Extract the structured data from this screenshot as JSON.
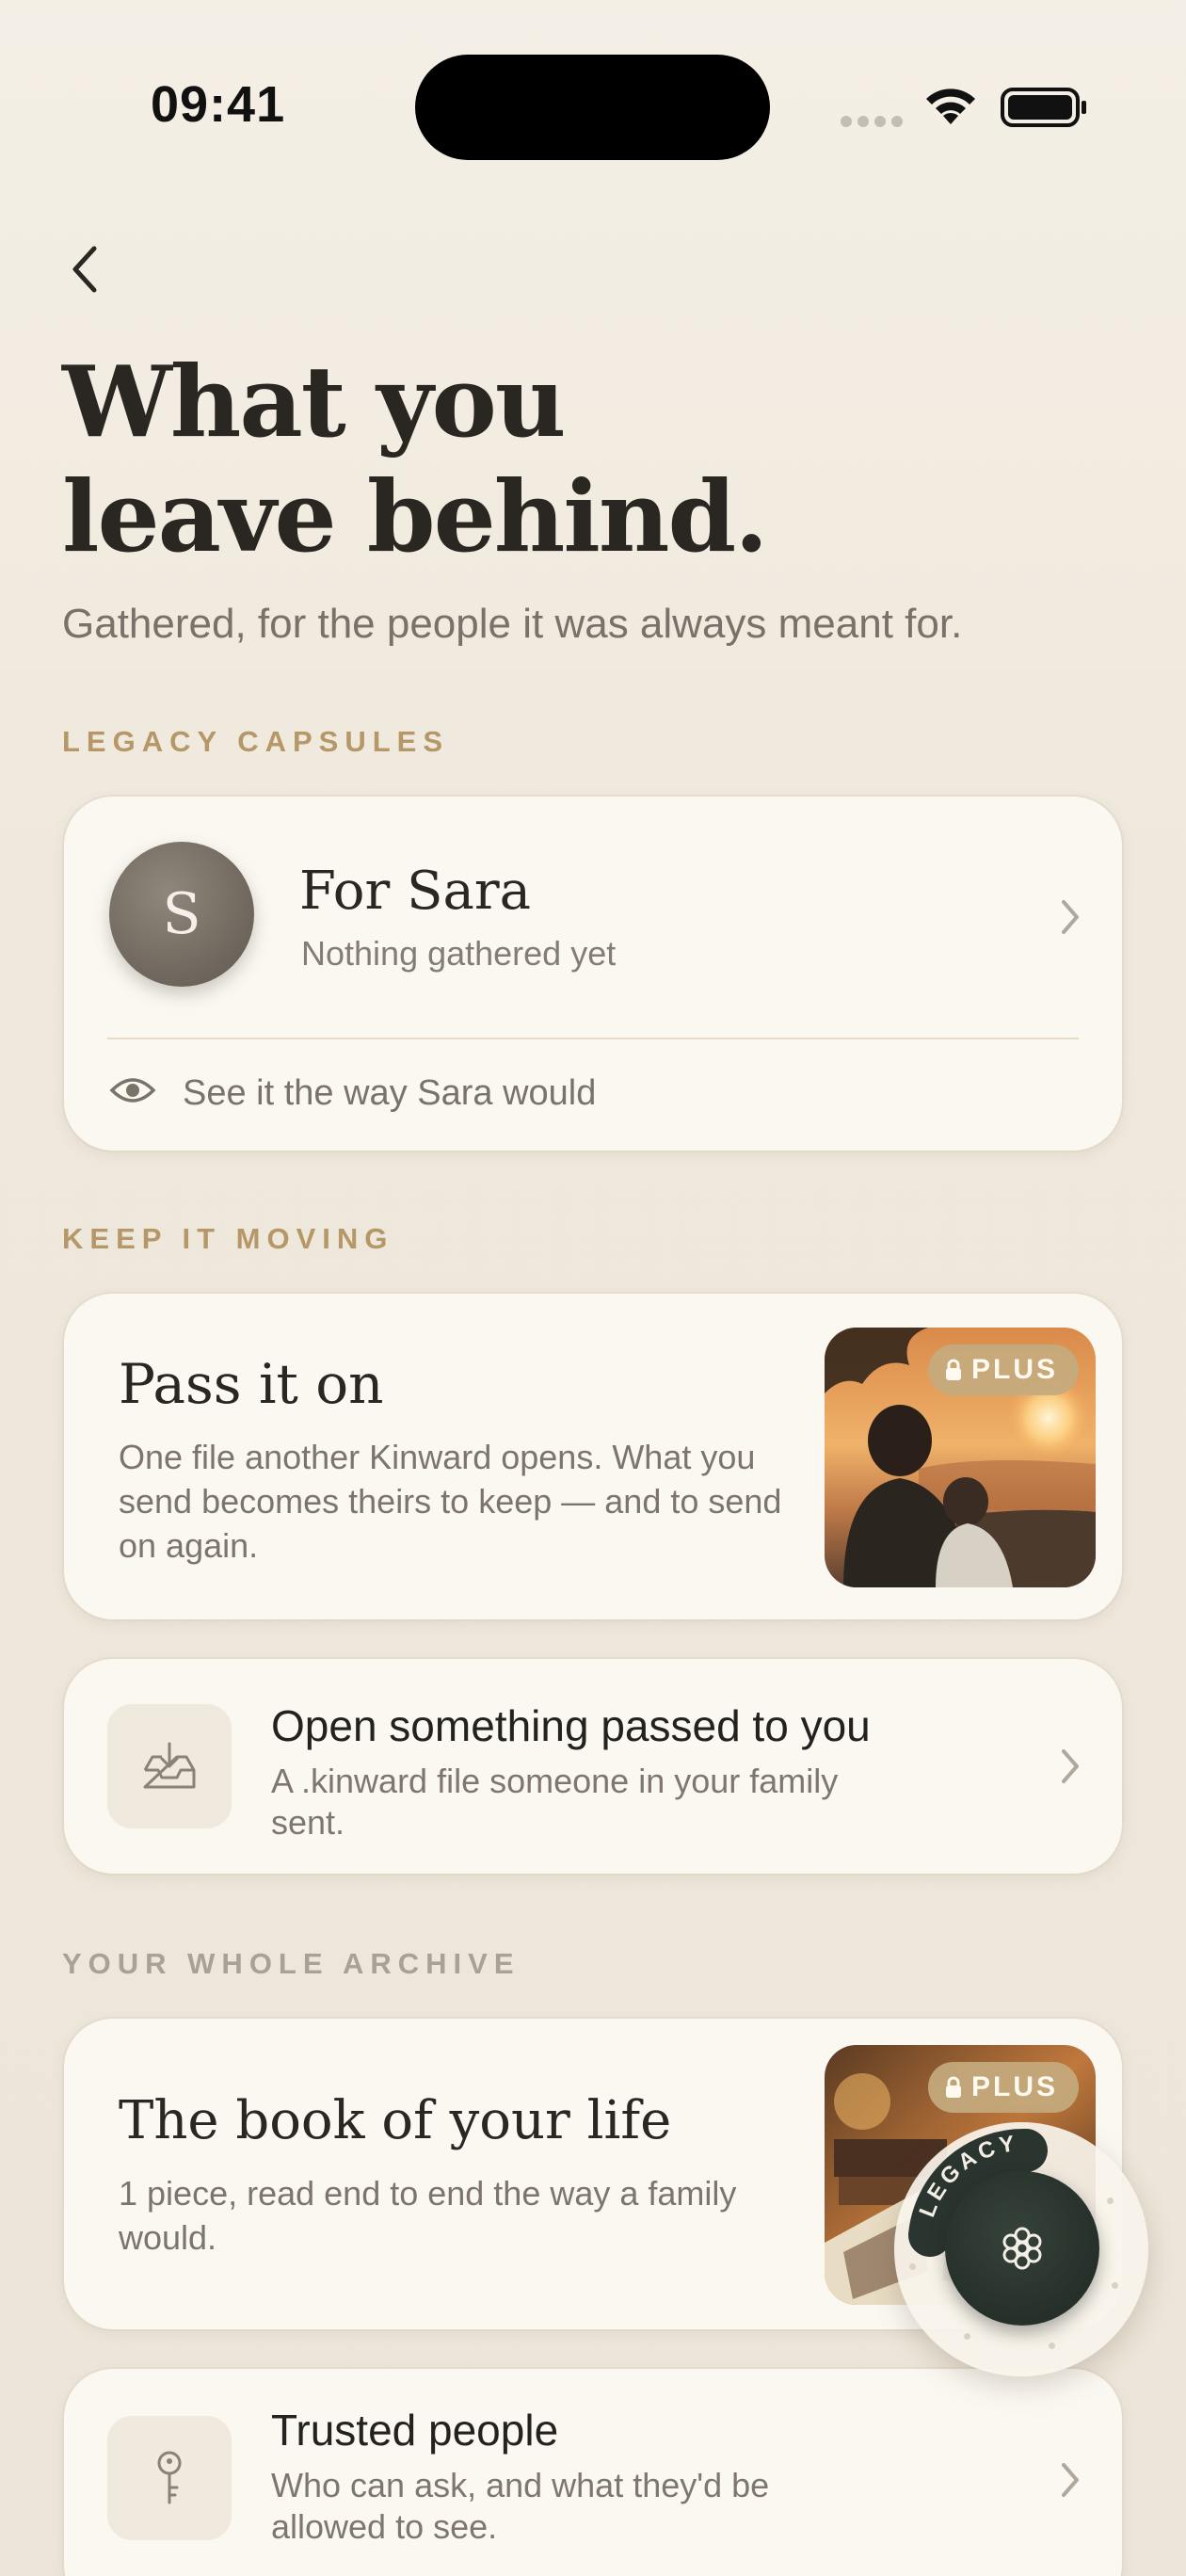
{
  "status_bar": {
    "time": "09:41"
  },
  "header": {
    "title_line1": "What you",
    "title_line2": "leave behind.",
    "subtitle": "Gathered, for the people it was always meant for."
  },
  "sections": {
    "legacy_capsules": "LEGACY CAPSULES",
    "keep_it_moving": "KEEP IT MOVING",
    "your_whole_archive": "YOUR WHOLE ARCHIVE"
  },
  "capsule": {
    "avatar_initial": "S",
    "name": "For Sara",
    "status": "Nothing gathered yet",
    "preview_label": "See it the way Sara would"
  },
  "pass_it_on": {
    "title": "Pass it on",
    "description": "One file another Kinward opens. What you send becomes theirs to keep — and to send on again.",
    "badge": "PLUS"
  },
  "open_passed": {
    "title": "Open something passed to you",
    "description": "A .kinward file someone in your family sent."
  },
  "book": {
    "title": "The book of your life",
    "description": "1 piece, read end to end the way a family would.",
    "badge": "PLUS"
  },
  "trusted": {
    "title": "Trusted people",
    "description": "Who can ask, and what they'd be allowed to see."
  },
  "legacy_dial": {
    "label": "LEGACY"
  },
  "colors": {
    "background": "#f0e9dd",
    "card": "#fbf8f2",
    "accent_gold": "#b59768",
    "badge_gold": "#c4aa7e",
    "dial_green": "#2b352f"
  },
  "icons": [
    "back-chevron-icon",
    "wifi-icon",
    "battery-icon",
    "eye-icon",
    "inbox-download-icon",
    "key-icon",
    "lock-icon",
    "flower-icon",
    "chevron-right-icon"
  ]
}
